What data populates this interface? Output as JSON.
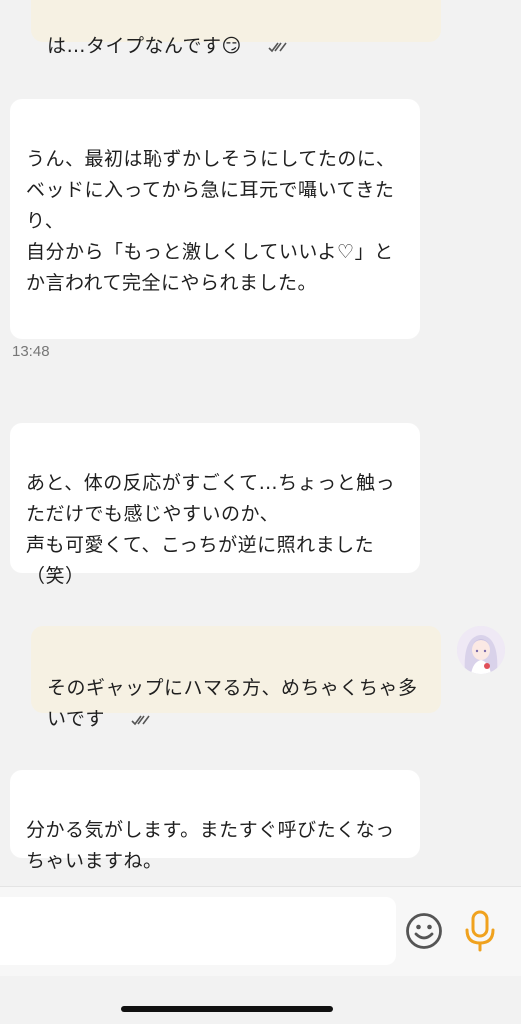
{
  "messages": [
    {
      "direction": "outgoing",
      "text": "は…タイプなんです😏"
    },
    {
      "direction": "incoming",
      "text": "うん、最初は恥ずかしそうにしてたのに、\nベッドに入ってから急に耳元で囁いてきたり、\n自分から「もっと激しくしていいよ♡」とか言われて完全にやられました。"
    },
    {
      "direction": "incoming",
      "text": "あと、体の反応がすごくて…ちょっと触っただけでも感じやすいのか、\n声も可愛くて、こっちが逆に照れました（笑）"
    },
    {
      "direction": "outgoing",
      "text": "そのギャップにハマる方、めちゃくちゃ多いです"
    },
    {
      "direction": "incoming",
      "text": "分かる気がします。またすぐ呼びたくなっちゃいますね。"
    }
  ],
  "timestamp": "13:48",
  "input": {
    "value": ""
  },
  "icons": {
    "read_status": "double-check-icon",
    "emoji": "smiley-icon",
    "mic": "microphone-icon",
    "avatar": "anime-avatar"
  },
  "colors": {
    "outgoing_bubble": "#f6f1e3",
    "incoming_bubble": "#ffffff",
    "background": "#f2f2f2",
    "mic_accent": "#f0a21e"
  }
}
